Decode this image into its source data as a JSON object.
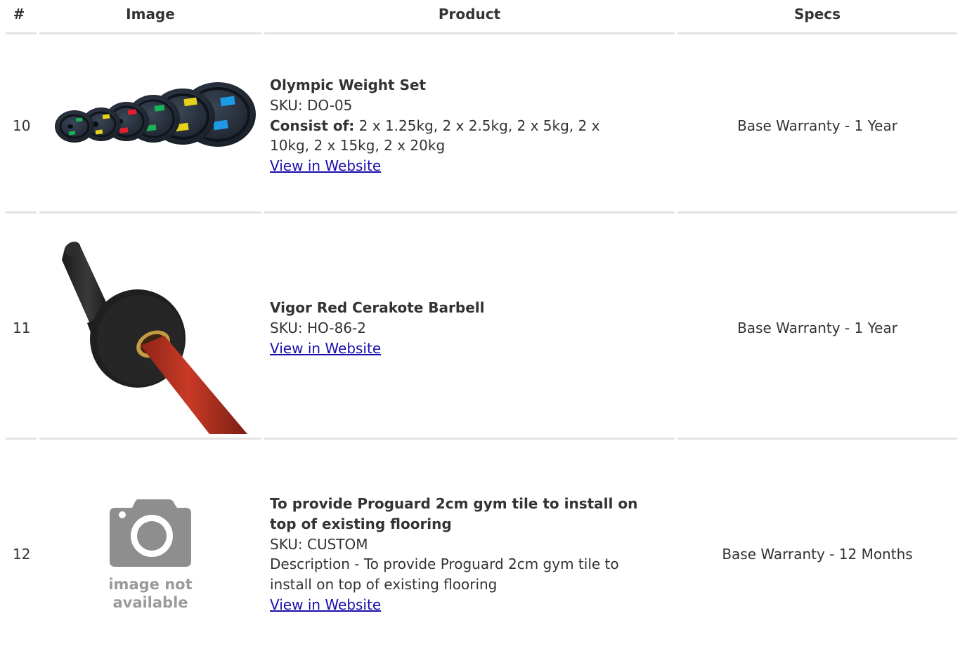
{
  "table": {
    "headers": {
      "num": "#",
      "image": "Image",
      "product": "Product",
      "specs": "Specs"
    },
    "rows": [
      {
        "num": "10",
        "name": "Olympic Weight Set",
        "sku": "SKU: DO-05",
        "consist_label": "Consist of:",
        "consist_line1": " 2 x 1.25kg, 2 x 2.5kg, 2 x 5kg, 2 x",
        "consist_line2": "10kg, 2 x 15kg, 2 x 20kg",
        "link": "View in Website",
        "spec": "Base Warranty - 1 Year",
        "image": "weight-plates-image"
      },
      {
        "num": "11",
        "name": "Vigor Red Cerakote Barbell",
        "sku": "SKU: HO-86-2",
        "link": "View in Website",
        "spec": "Base Warranty - 1 Year",
        "image": "barbell-image"
      },
      {
        "num": "12",
        "name_line1": "To provide Proguard 2cm gym tile to install on",
        "name_line2": "top of existing flooring",
        "sku": "SKU: CUSTOM",
        "desc_line1": "Description - To provide Proguard 2cm gym tile to",
        "desc_line2": "install on top of existing flooring",
        "link": "View in Website",
        "spec": "Base Warranty - 12 Months",
        "image": "camera-icon",
        "placeholder_line1": "image not",
        "placeholder_line2": "available"
      }
    ]
  },
  "colors": {
    "text": "#333333",
    "link": "#1a0dab",
    "divider": "#e3e3e3",
    "placeholder": "#9a9a9a"
  }
}
